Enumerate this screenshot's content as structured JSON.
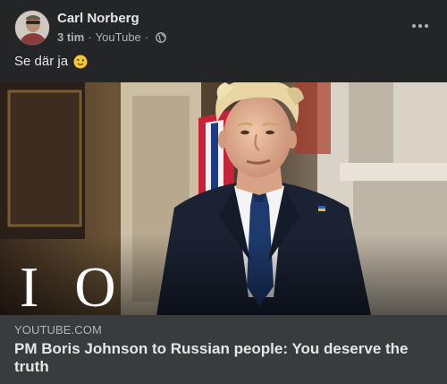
{
  "post": {
    "author": "Carl Norberg",
    "time": "3 tim",
    "source": "YouTube",
    "separator": "·",
    "message": "Se där ja"
  },
  "icons": {
    "avatar": "profile-photo",
    "globe": "globe-icon",
    "more": "more-options-icon",
    "emoji": "winking-face-emoji"
  },
  "link_preview": {
    "logo_text": "I O",
    "domain": "YOUTUBE.COM",
    "title": "PM Boris Johnson to Russian people: You deserve the truth"
  },
  "colors": {
    "background": "#242526",
    "link_box": "#3a3b3c",
    "primary_text": "#e4e6eb",
    "secondary_text": "#b0b3b8"
  }
}
